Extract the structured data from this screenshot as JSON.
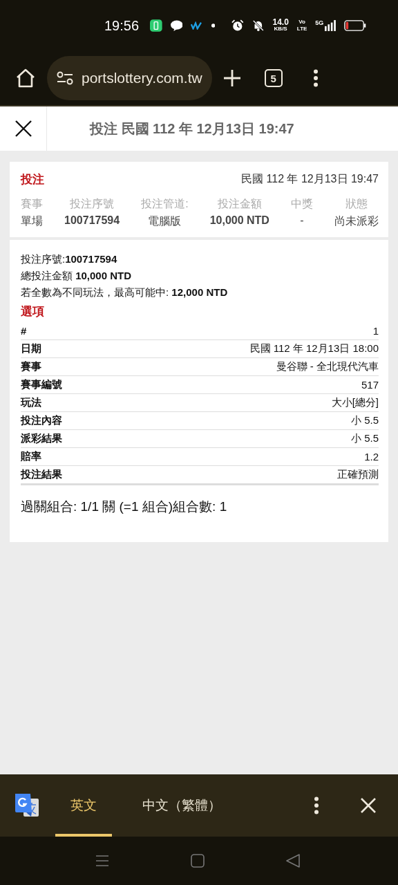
{
  "status_bar": {
    "time": "19:56",
    "net_speed": "14.0",
    "net_unit": "KB/S",
    "volte": [
      "Vo",
      "LTE"
    ],
    "network": "5G"
  },
  "browser": {
    "url": "portslottery.com.tw",
    "tab_count": "5"
  },
  "header": {
    "title": "投注 民國 112 年 12月13日 19:47"
  },
  "summary": {
    "label": "投注",
    "datetime": "民國 112 年 12月13日 19:47",
    "columns": [
      {
        "head": "賽事",
        "value": "單場"
      },
      {
        "head": "投注序號",
        "value": "100717594"
      },
      {
        "head": "投注管道:",
        "value": "電腦版"
      },
      {
        "head": "投注金額",
        "value": "10,000 NTD"
      },
      {
        "head": "中獎",
        "value": "-"
      },
      {
        "head": "狀態",
        "value": "尚未派彩"
      }
    ]
  },
  "detail": {
    "lines": [
      "投注序號:**100717594**",
      "總投注金額 **10,000 NTD**",
      "若全數為不同玩法，最高可能中: **12,000 NTD**"
    ],
    "section": "選項",
    "rows": [
      {
        "key": "#",
        "value": "1"
      },
      {
        "key": "日期",
        "value": "民國 112 年 12月13日 18:00"
      },
      {
        "key": "賽事",
        "value": "曼谷聯 - 全北現代汽車"
      },
      {
        "key": "賽事編號",
        "value": "517"
      },
      {
        "key": "玩法",
        "value": "大小[總分]"
      },
      {
        "key": "投注內容",
        "value": "小 5.5"
      },
      {
        "key": "派彩結果",
        "value": "小 5.5"
      },
      {
        "key": "賠率",
        "value": "1.2"
      },
      {
        "key": "投注結果",
        "value": "正確預測"
      }
    ],
    "footer": "過關組合: 1/1 關 (=1 組合)組合數: 1"
  },
  "translate_bar": {
    "tabs": [
      {
        "label": "英文",
        "selected": true
      },
      {
        "label": "中文（繁體）",
        "selected": false
      }
    ]
  }
}
